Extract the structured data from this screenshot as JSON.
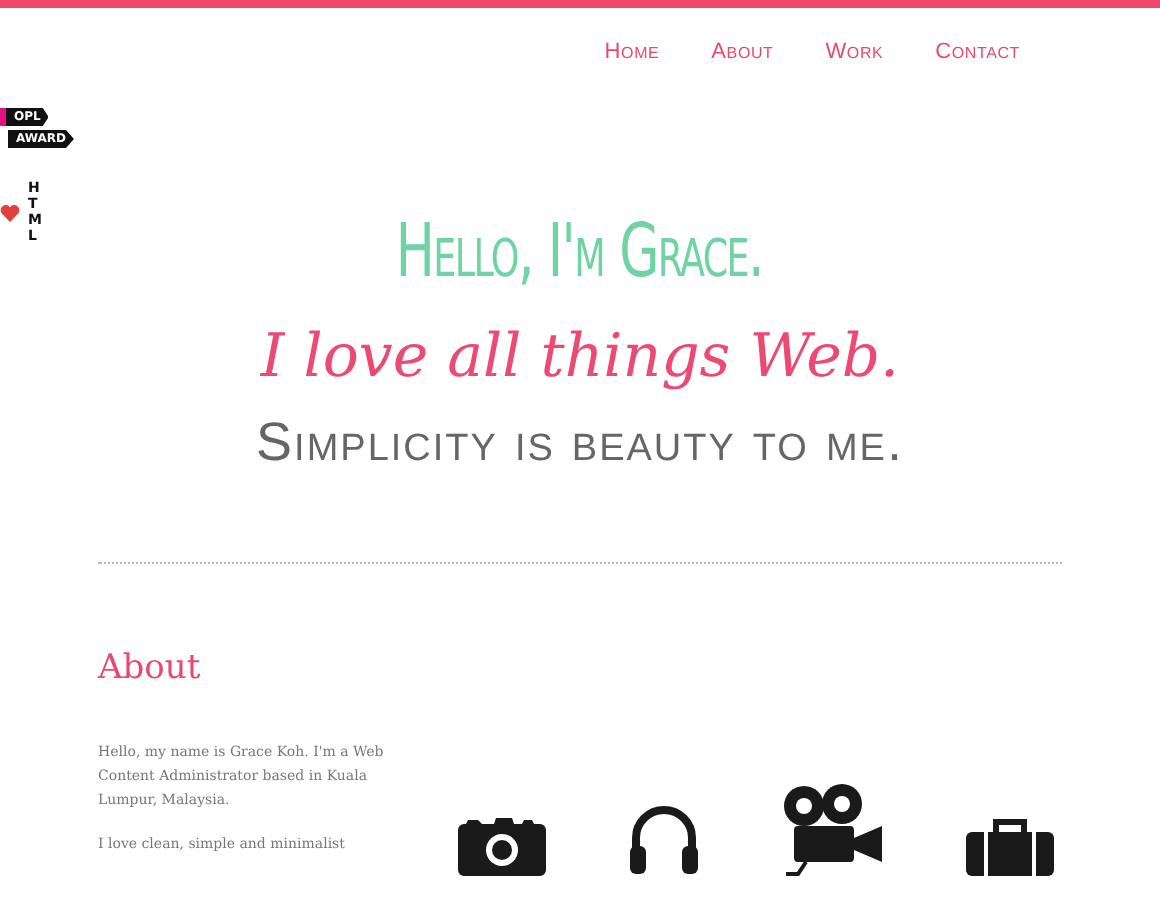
{
  "nav": [
    {
      "label": "Home"
    },
    {
      "label": "About"
    },
    {
      "label": "Work"
    },
    {
      "label": "Contact"
    }
  ],
  "badges": {
    "award": [
      "OPL",
      "AWARD"
    ],
    "html": "HTML"
  },
  "hero": {
    "greeting": "Hello, I'm Grace.",
    "tagline": "I love all things Web.",
    "motto": "Simplicity is beauty to me."
  },
  "about": {
    "heading": "About",
    "paragraphs": [
      "Hello, my name is Grace Koh. I'm a Web Content Administrator based in Kuala Lumpur, Malaysia.",
      "I love clean, simple and minimalist"
    ]
  },
  "skills": [
    {
      "kind": "camera"
    },
    {
      "kind": "headphones"
    },
    {
      "kind": "film"
    },
    {
      "kind": "briefcase"
    }
  ]
}
